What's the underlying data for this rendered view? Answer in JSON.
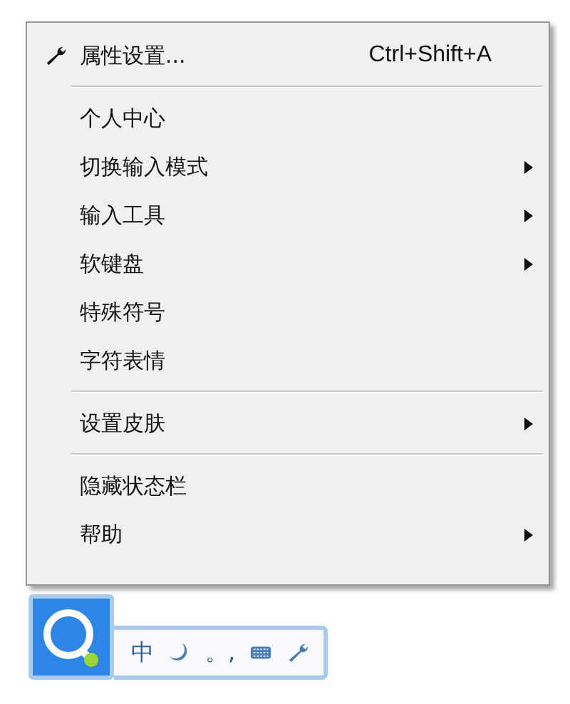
{
  "menu": [
    {
      "kind": "tool_item",
      "label": "属性设置...",
      "shortcut": "Ctrl+Shift+A",
      "submenu": false
    },
    {
      "kind": "separator"
    },
    {
      "kind": "item",
      "label": "个人中心",
      "submenu": false
    },
    {
      "kind": "item",
      "label": "切换输入模式",
      "submenu": true
    },
    {
      "kind": "item",
      "label": "输入工具",
      "submenu": true
    },
    {
      "kind": "item",
      "label": "软键盘",
      "submenu": true
    },
    {
      "kind": "item",
      "label": "特殊符号",
      "submenu": false
    },
    {
      "kind": "item",
      "label": "字符表情",
      "submenu": false
    },
    {
      "kind": "separator"
    },
    {
      "kind": "item",
      "label": "设置皮肤",
      "submenu": true
    },
    {
      "kind": "separator"
    },
    {
      "kind": "item",
      "label": "隐藏状态栏",
      "submenu": false
    },
    {
      "kind": "item",
      "label": "帮助",
      "submenu": true
    }
  ],
  "status_bar": {
    "tools": [
      {
        "kind": "text",
        "label": "中"
      },
      {
        "kind": "moon"
      },
      {
        "kind": "text",
        "label": "。,"
      },
      {
        "kind": "keyboard"
      },
      {
        "kind": "wrench"
      }
    ]
  }
}
